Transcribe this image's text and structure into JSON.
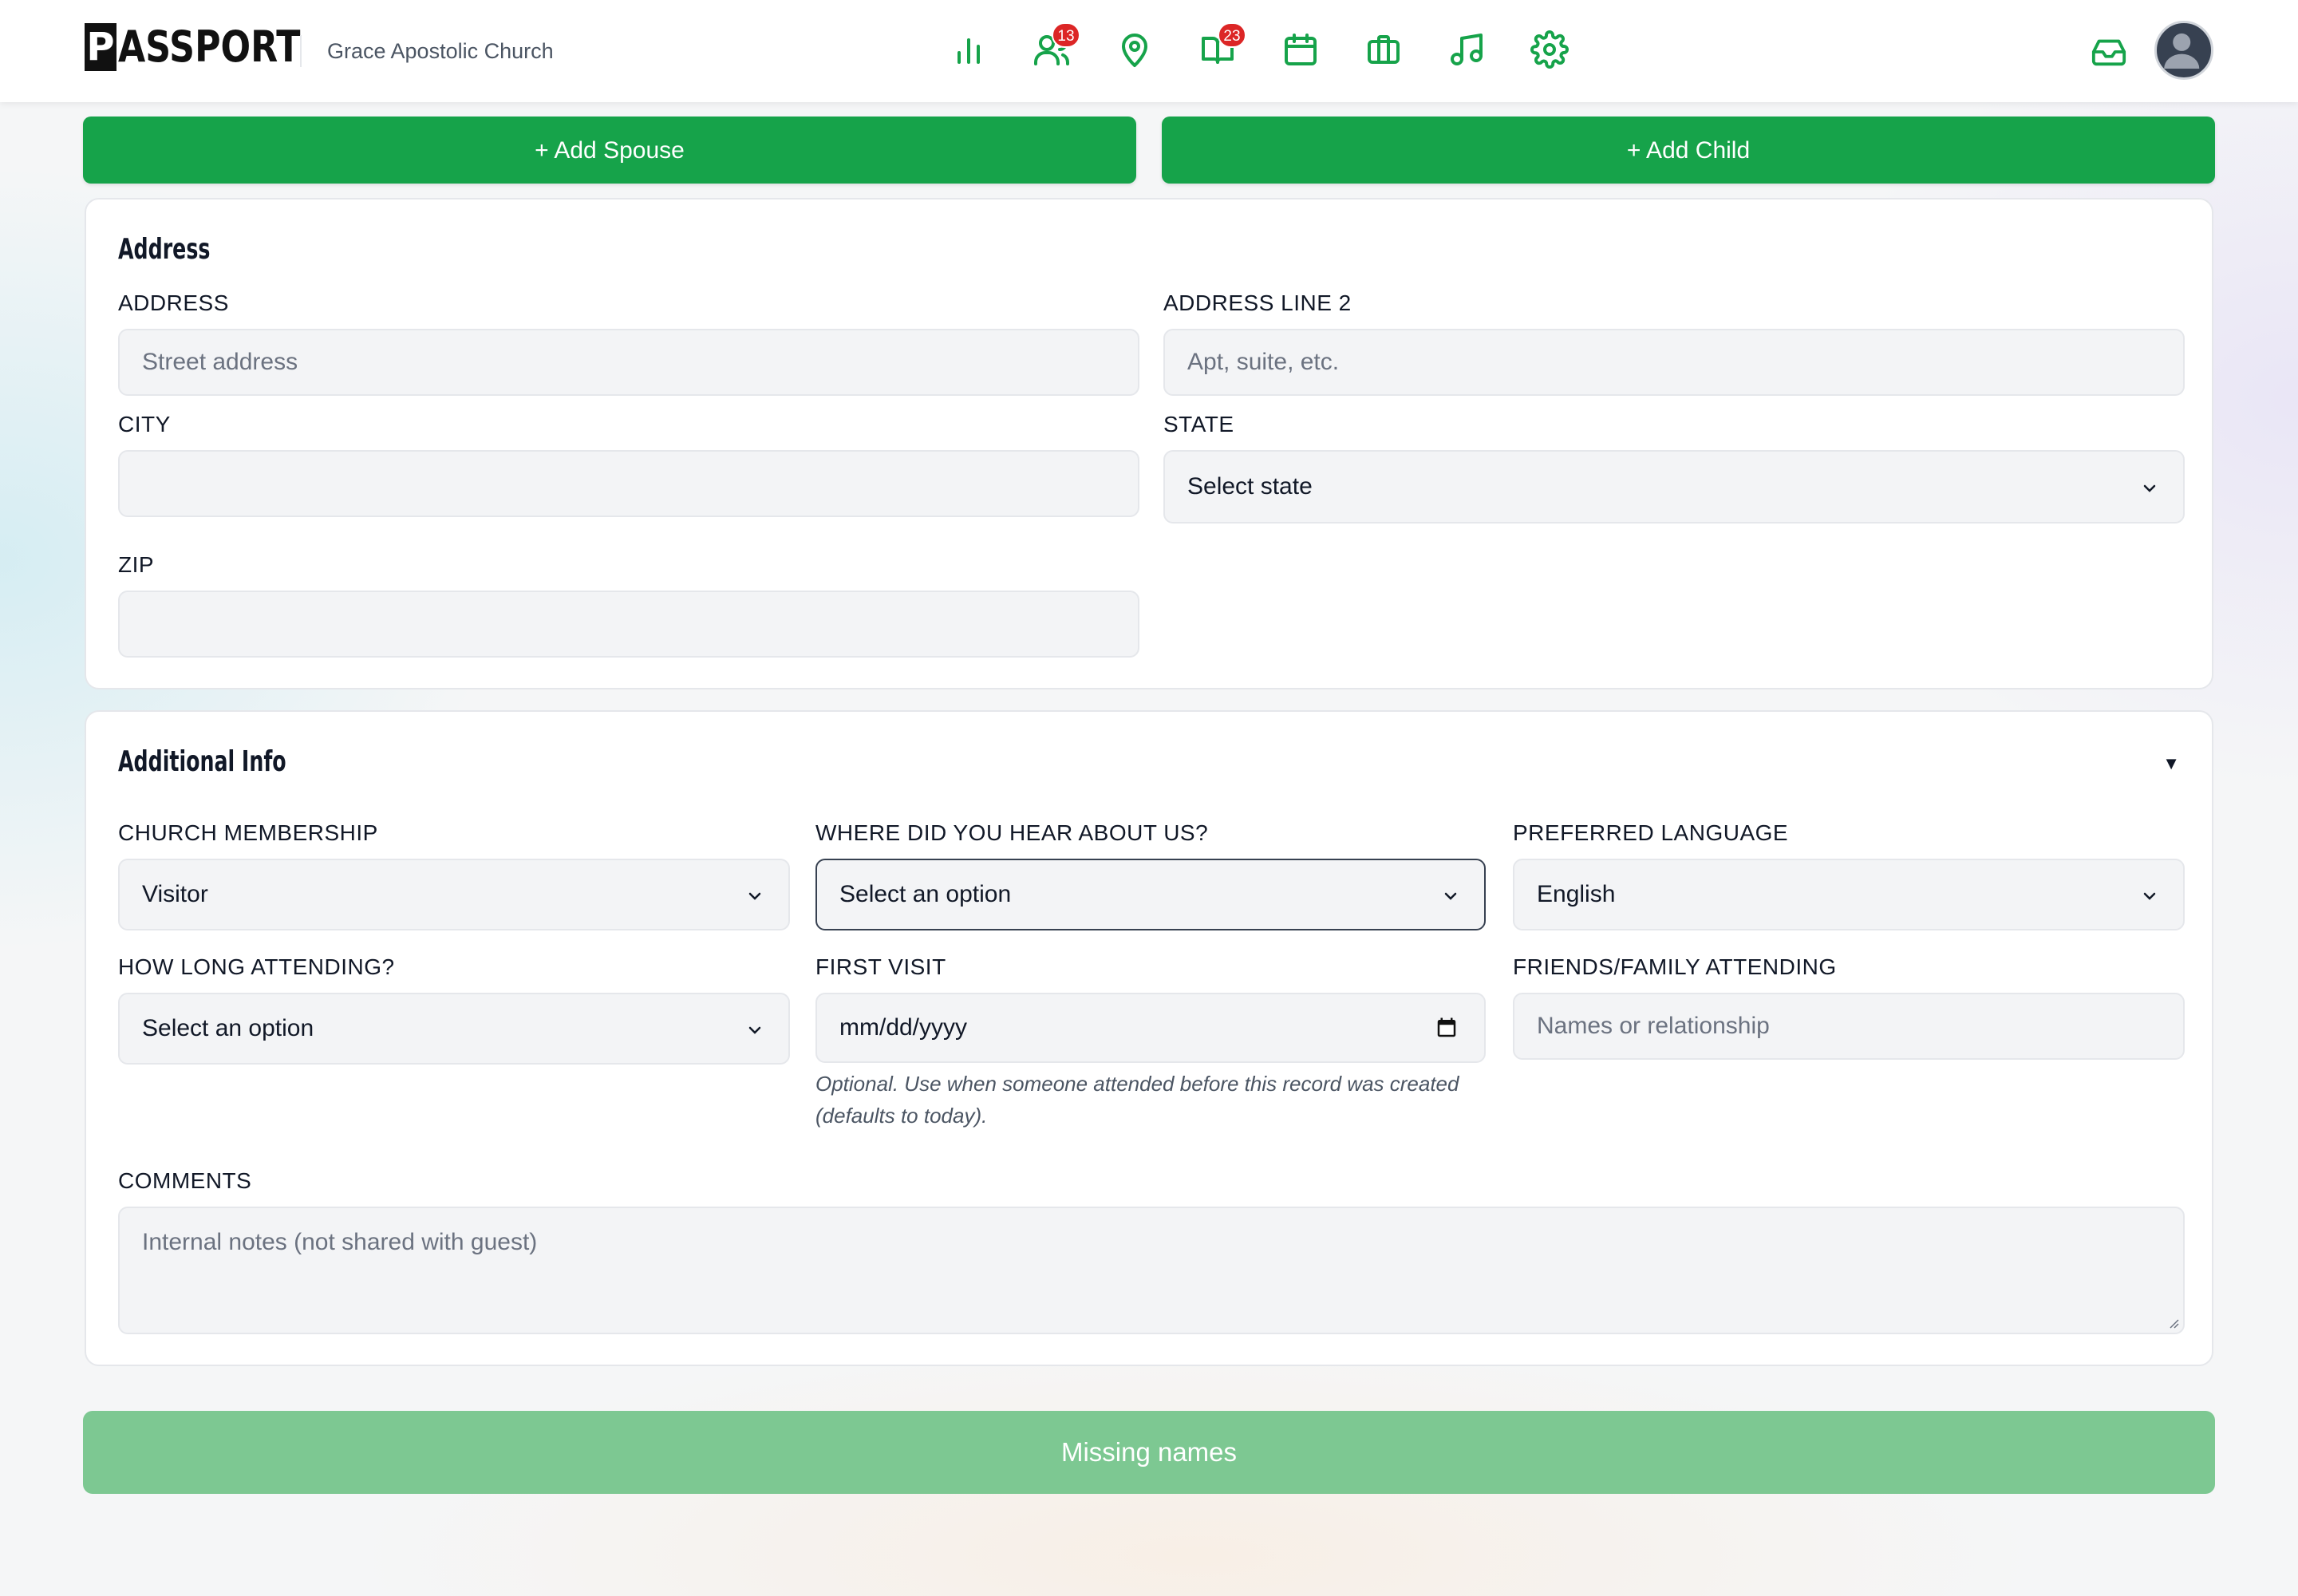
{
  "header": {
    "logo_mark": "P",
    "logo_text": "ASSPORT",
    "org_name": "Grace Apostolic Church",
    "nav": [
      {
        "icon": "bar-chart-icon"
      },
      {
        "icon": "people-icon",
        "badge": "13"
      },
      {
        "icon": "location-pin-icon"
      },
      {
        "icon": "book-icon",
        "badge": "23"
      },
      {
        "icon": "calendar-icon"
      },
      {
        "icon": "briefcase-icon"
      },
      {
        "icon": "music-note-icon"
      },
      {
        "icon": "gear-icon"
      }
    ],
    "accent_color": "#16a34a"
  },
  "actions": {
    "add_spouse": "+ Add Spouse",
    "add_child": "+ Add Child"
  },
  "address": {
    "title": "Address",
    "address_label": "ADDRESS",
    "address_placeholder": "Street address",
    "address2_label": "ADDRESS LINE 2",
    "address2_placeholder": "Apt, suite, etc.",
    "city_label": "CITY",
    "city_value": "",
    "state_label": "STATE",
    "state_value": "Select state",
    "zip_label": "ZIP",
    "zip_value": ""
  },
  "additional": {
    "title": "Additional Info",
    "toggle": "▼",
    "membership_label": "CHURCH MEMBERSHIP",
    "membership_value": "Visitor",
    "hear_label": "WHERE DID YOU HEAR ABOUT US?",
    "hear_value": "Select an option",
    "language_label": "PREFERRED LANGUAGE",
    "language_value": "English",
    "howlong_label": "HOW LONG ATTENDING?",
    "howlong_value": "Select an option",
    "first_visit_label": "FIRST VISIT",
    "first_visit_value": "mm/dd/yyyy",
    "first_visit_help": "Optional. Use when someone attended before this record was created (defaults to today).",
    "friends_label": "FRIENDS/FAMILY ATTENDING",
    "friends_placeholder": "Names or relationship",
    "comments_label": "COMMENTS",
    "comments_placeholder": "Internal notes (not shared with guest)"
  },
  "submit": {
    "label": "Missing names",
    "color": "#7dc892"
  }
}
